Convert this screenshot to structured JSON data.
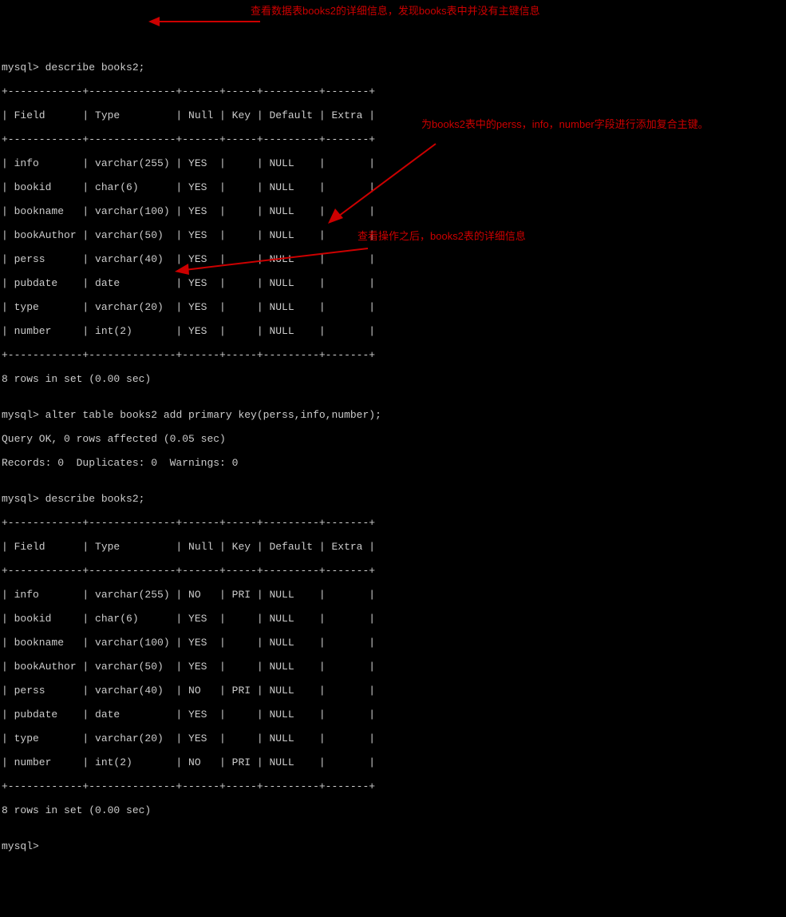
{
  "terminal": {
    "prompt": "mysql>",
    "cmd_describe1": " describe books2;",
    "table1_header": "| Field      | Type         | Null | Key | Default | Extra |",
    "table1_sep_top": "+------------+--------------+------+-----+---------+-------+",
    "table1_rows": [
      "| info       | varchar(255) | YES  |     | NULL    |       |",
      "| bookid     | char(6)      | YES  |     | NULL    |       |",
      "| bookname   | varchar(100) | YES  |     | NULL    |       |",
      "| bookAuthor | varchar(50)  | YES  |     | NULL    |       |",
      "| perss      | varchar(40)  | YES  |     | NULL    |       |",
      "| pubdate    | date         | YES  |     | NULL    |       |",
      "| type       | varchar(20)  | YES  |     | NULL    |       |",
      "| number     | int(2)       | YES  |     | NULL    |       |"
    ],
    "result1": "8 rows in set (0.00 sec)",
    "blank": "",
    "cmd_alter": " alter table books2 add primary key(perss,info,number);",
    "alter_result1": "Query OK, 0 rows affected (0.05 sec)",
    "alter_result2": "Records: 0  Duplicates: 0  Warnings: 0",
    "cmd_describe2": " describe books2;",
    "table2_header": "| Field      | Type         | Null | Key | Default | Extra |",
    "table2_sep_top": "+------------+--------------+------+-----+---------+-------+",
    "table2_rows": [
      "| info       | varchar(255) | NO   | PRI | NULL    |       |",
      "| bookid     | char(6)      | YES  |     | NULL    |       |",
      "| bookname   | varchar(100) | YES  |     | NULL    |       |",
      "| bookAuthor | varchar(50)  | YES  |     | NULL    |       |",
      "| perss      | varchar(40)  | NO   | PRI | NULL    |       |",
      "| pubdate    | date         | YES  |     | NULL    |       |",
      "| type       | varchar(20)  | YES  |     | NULL    |       |",
      "| number     | int(2)       | NO   | PRI | NULL    |       |"
    ],
    "result2": "8 rows in set (0.00 sec)",
    "prompt_final": "mysql>"
  },
  "annotations": {
    "anno1": "查看数据表books2的详细信息，发现books表中并没有主键信息",
    "anno2": "为books2表中的perss，info，number字段进行添加复合主键。",
    "anno3": "查看操作之后，books2表的详细信息"
  }
}
